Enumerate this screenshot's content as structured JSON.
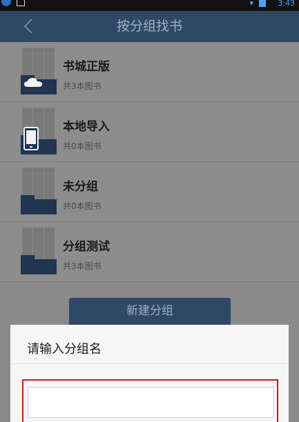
{
  "status_bar": {
    "time": "3:43"
  },
  "header": {
    "title": "按分组找书"
  },
  "groups": [
    {
      "name": "书城正版",
      "count": "共3本图书",
      "icon": "cloud-folder-icon"
    },
    {
      "name": "本地导入",
      "count": "共0本图书",
      "icon": "phone-folder-icon"
    },
    {
      "name": "未分组",
      "count": "共0本图书",
      "icon": "folder-icon"
    },
    {
      "name": "分组测试",
      "count": "共3本图书",
      "icon": "folder-icon"
    }
  ],
  "new_group_button": {
    "label": "新建分组"
  },
  "dialog": {
    "title": "请输入分组名",
    "input_value": "",
    "input_placeholder": ""
  },
  "colors": {
    "header_bg": "#2e4965",
    "folder": "#1f3550",
    "highlight": "#d6111b",
    "status_accent": "#4aa3ff"
  }
}
